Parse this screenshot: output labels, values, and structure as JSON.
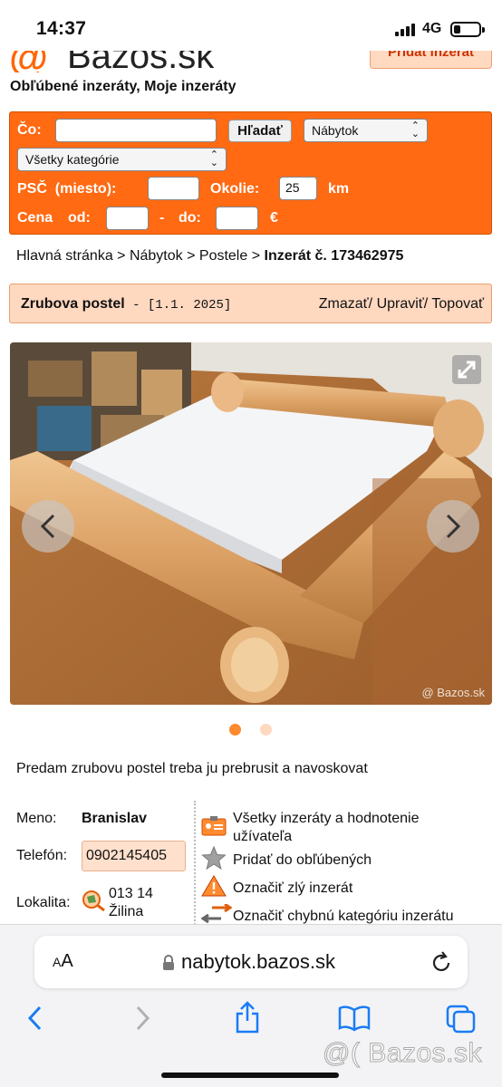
{
  "status_bar": {
    "time": "14:37",
    "network": "4G"
  },
  "header": {
    "logo_at": "@",
    "logo_text": "Bazos.sk",
    "add_listing_label": "Pridat inzerat",
    "favorites_link": "Obľúbené inzeráty",
    "separator": ", ",
    "my_listings_link": "Moje inzeráty"
  },
  "search": {
    "what_label": "Čo:",
    "what_value": "",
    "search_button": "Hľadať",
    "section_select": "Nábytok",
    "category_select": "Všetky kategórie",
    "psc_label": "PSČ",
    "psc_sub_label": "(miesto):",
    "psc_value": "",
    "radius_label": "Okolie:",
    "radius_value": "25",
    "radius_unit": "km",
    "price_label": "Cena",
    "price_from_label": "od:",
    "price_from_value": "",
    "price_dash": "-",
    "price_to_label": "do:",
    "price_to_value": "",
    "currency": "€"
  },
  "breadcrumb": {
    "home": "Hlavná stránka",
    "sep": " > ",
    "section": "Nábytok",
    "category": "Postele",
    "current": "Inzerát č. 173462975"
  },
  "listing": {
    "title": "Zrubova postel",
    "title_sep": " - ",
    "date": "[1.1. 2025]",
    "delete": "Zmazať/",
    "edit": "Upraviť/",
    "top": "Topovať",
    "photo_watermark": "@ Bazos.sk",
    "photo_count": 2,
    "active_photo": 1,
    "description": "Predam zrubovu postel treba ju prebrusit a navoskovat"
  },
  "seller": {
    "name_label": "Meno:",
    "name": "Branislav",
    "phone_label": "Telefón:",
    "phone": "0902145405",
    "location_label": "Lokalita:",
    "postal_code": "013 14",
    "city": "Žilina"
  },
  "actions": {
    "all_listings_line1": "Všetky inzeráty a hodnotenie",
    "all_listings_line2": "užívateľa",
    "add_favorite": "Pridať do obľúbených",
    "report_bad": "Označiť zlý inzerát",
    "report_category": "Označiť chybnú kategóriu inzerátu"
  },
  "browser": {
    "text_size": "AA",
    "url": "nabytok.bazos.sk"
  },
  "overlay_watermark": "@( Bazos.sk",
  "colors": {
    "accent": "#ff6a13",
    "title_bg": "#ffd8c0",
    "dot_active": "#ff8a30",
    "dot_inactive": "#ffd8c0"
  }
}
